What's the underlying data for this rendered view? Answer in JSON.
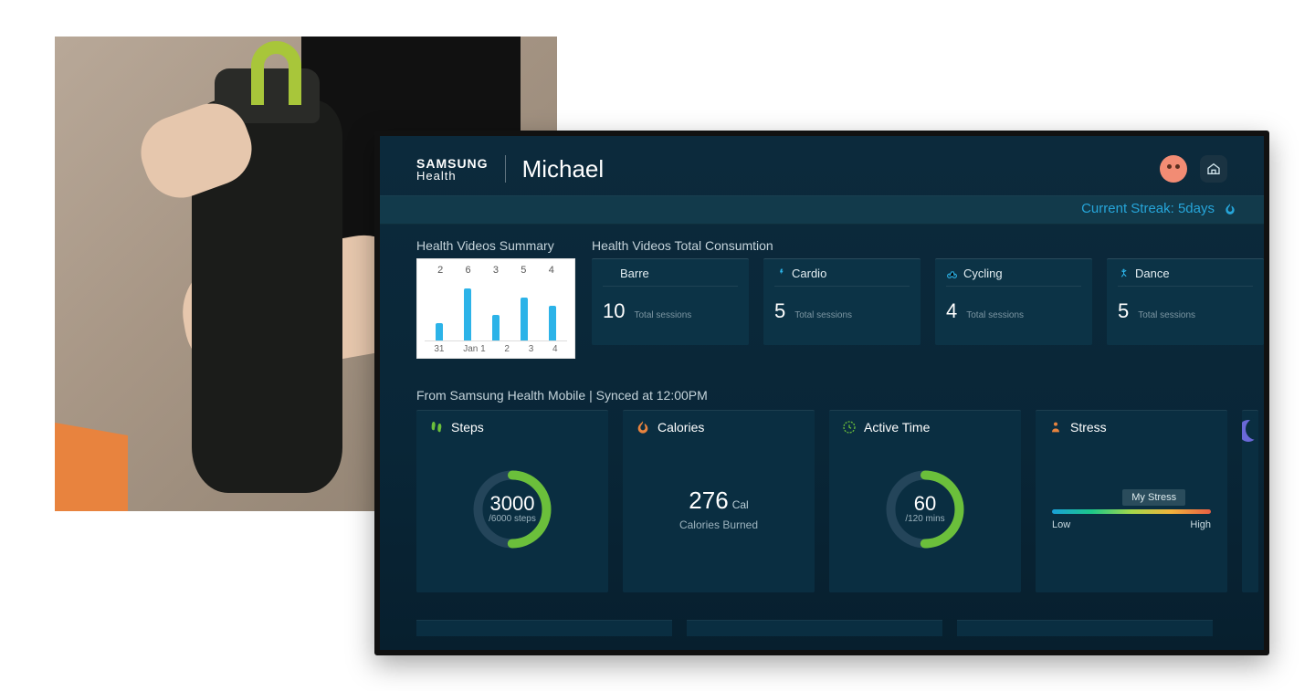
{
  "brand": {
    "line1": "SAMSUNG",
    "line2": "Health"
  },
  "user": {
    "name": "Michael"
  },
  "streak": {
    "label": "Current Streak: 5days"
  },
  "summary": {
    "title": "Health Videos Summary"
  },
  "chart_data": {
    "type": "bar",
    "categories": [
      "31",
      "Jan 1",
      "2",
      "3",
      "4"
    ],
    "values": [
      2,
      6,
      3,
      5,
      4
    ],
    "title": "Health Videos Summary",
    "xlabel": "",
    "ylabel": "",
    "ylim": [
      0,
      7
    ]
  },
  "consumption": {
    "title": "Health Videos Total Consumtion",
    "sessions_label": "Total sessions",
    "items": [
      {
        "name": "Barre",
        "count": "10",
        "color": "#2cb3e8"
      },
      {
        "name": "Cardio",
        "count": "5",
        "color": "#2cb3e8"
      },
      {
        "name": "Cycling",
        "count": "4",
        "color": "#2cb3e8"
      },
      {
        "name": "Dance",
        "count": "5",
        "color": "#2cb3e8"
      }
    ]
  },
  "sync_text": "From Samsung Health Mobile | Synced at 12:00PM",
  "metrics": {
    "steps": {
      "label": "Steps",
      "value": "3000",
      "goal": "/6000 steps",
      "progress": 0.5
    },
    "calories": {
      "label": "Calories",
      "value": "276",
      "unit": "Cal",
      "sub": "Calories Burned"
    },
    "active": {
      "label": "Active Time",
      "value": "60",
      "goal": "/120 mins",
      "progress": 0.5
    },
    "stress": {
      "label": "Stress",
      "badge": "My Stress",
      "low": "Low",
      "high": "High",
      "position": 0.72
    }
  }
}
